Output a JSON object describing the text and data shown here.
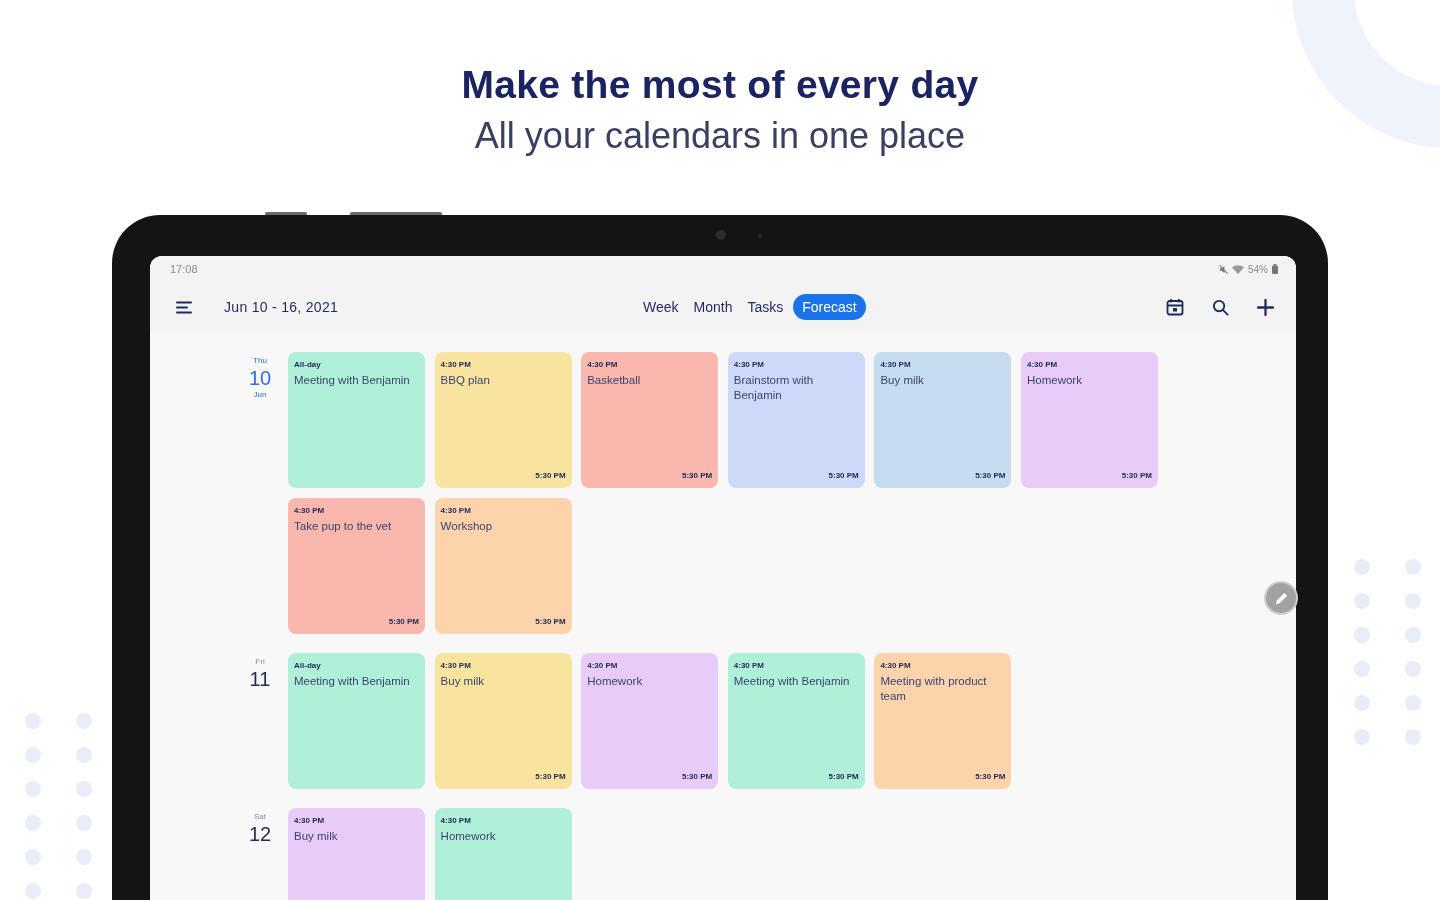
{
  "hero": {
    "title": "Make the most of every day",
    "subtitle": "All your calendars in one place"
  },
  "status_bar": {
    "time": "17:08",
    "battery": "54%"
  },
  "app_bar": {
    "date_range": "Jun 10 - 16, 2021",
    "tabs": [
      {
        "label": "Week",
        "selected": false
      },
      {
        "label": "Month",
        "selected": false
      },
      {
        "label": "Tasks",
        "selected": false
      },
      {
        "label": "Forecast",
        "selected": true
      }
    ]
  },
  "days": [
    {
      "weekday": "Thu",
      "date": "10",
      "month": "Jun",
      "today": true,
      "events": [
        {
          "start": "All-day",
          "title": "Meeting with Benjamin",
          "color": "#b1f0d8"
        },
        {
          "start": "4:30 PM",
          "title": "BBQ plan",
          "end": "5:30 PM",
          "color": "#f9e49f"
        },
        {
          "start": "4:30 PM",
          "title": "Basketball",
          "end": "5:30 PM",
          "color": "#f9b7ae"
        },
        {
          "start": "4:30 PM",
          "title": "Brainstorm with Benjamin",
          "end": "5:30 PM",
          "color": "#ccd9f9"
        },
        {
          "start": "4:30 PM",
          "title": "Buy milk",
          "end": "5:30 PM",
          "color": "#c5dbef"
        },
        {
          "start": "4:30 PM",
          "title": "Homework",
          "end": "5:30 PM",
          "color": "#e8cbf9"
        },
        {
          "start": "4:30 PM",
          "title": "Take pup to the vet",
          "end": "5:30 PM",
          "color": "#f9b7ae"
        },
        {
          "start": "4:30 PM",
          "title": "Workshop",
          "end": "5:30 PM",
          "color": "#fdd3ac"
        }
      ]
    },
    {
      "weekday": "Fri",
      "date": "11",
      "today": false,
      "events": [
        {
          "start": "All-day",
          "title": "Meeting with Benjamin",
          "color": "#b1f0d8"
        },
        {
          "start": "4:30 PM",
          "title": "Buy milk",
          "end": "5:30 PM",
          "color": "#f9e49f"
        },
        {
          "start": "4:30 PM",
          "title": "Homework",
          "end": "5:30 PM",
          "color": "#e8cbf9"
        },
        {
          "start": "4:30 PM",
          "title": "Meeting with Benjamin",
          "end": "5:30 PM",
          "color": "#b1f0d8"
        },
        {
          "start": "4:30 PM",
          "title": "Meeting with product team",
          "end": "5:30 PM",
          "color": "#fdd3ac"
        }
      ]
    },
    {
      "weekday": "Sat",
      "date": "12",
      "today": false,
      "events": [
        {
          "start": "4:30 PM",
          "title": "Buy milk",
          "color": "#e8cbf9"
        },
        {
          "start": "4:30 PM",
          "title": "Homework",
          "color": "#b1f0d8"
        }
      ]
    }
  ]
}
